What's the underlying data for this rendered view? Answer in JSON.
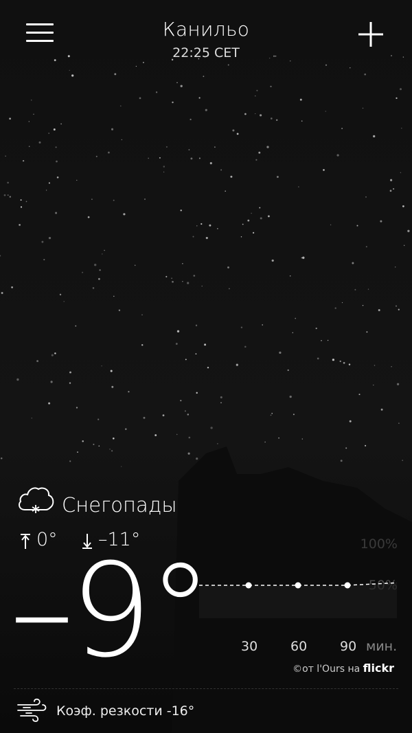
{
  "header": {
    "title": "Канильо",
    "time": "22:25 CET",
    "menu_icon": "hamburger-menu-icon",
    "add_icon": "plus-icon"
  },
  "current": {
    "condition": "Снегопады",
    "condition_icon": "cloud-snow-icon",
    "high": "0°",
    "low": "–11°",
    "temperature": "–9°"
  },
  "precip_chart": {
    "pct_100": "100%",
    "pct_50": "50%",
    "x_labels": [
      "30",
      "60",
      "90",
      "мин."
    ]
  },
  "chart_data": {
    "type": "line",
    "title": "",
    "xlabel": "мин.",
    "ylabel": "",
    "x": [
      0,
      30,
      60,
      90,
      120
    ],
    "values": [
      40,
      40,
      40,
      40,
      43
    ],
    "ylim": [
      0,
      100
    ],
    "xticks": [
      30,
      60,
      90
    ],
    "yticks": [
      "50%",
      "100%"
    ]
  },
  "credit": {
    "prefix": "©от l'Ours на",
    "brand": "flickr"
  },
  "wind_chill": {
    "label": "Коэф. резкости -16°",
    "icon": "wind-icon"
  },
  "colors": {
    "background": "#0b0b0b",
    "text": "#ffffff"
  }
}
